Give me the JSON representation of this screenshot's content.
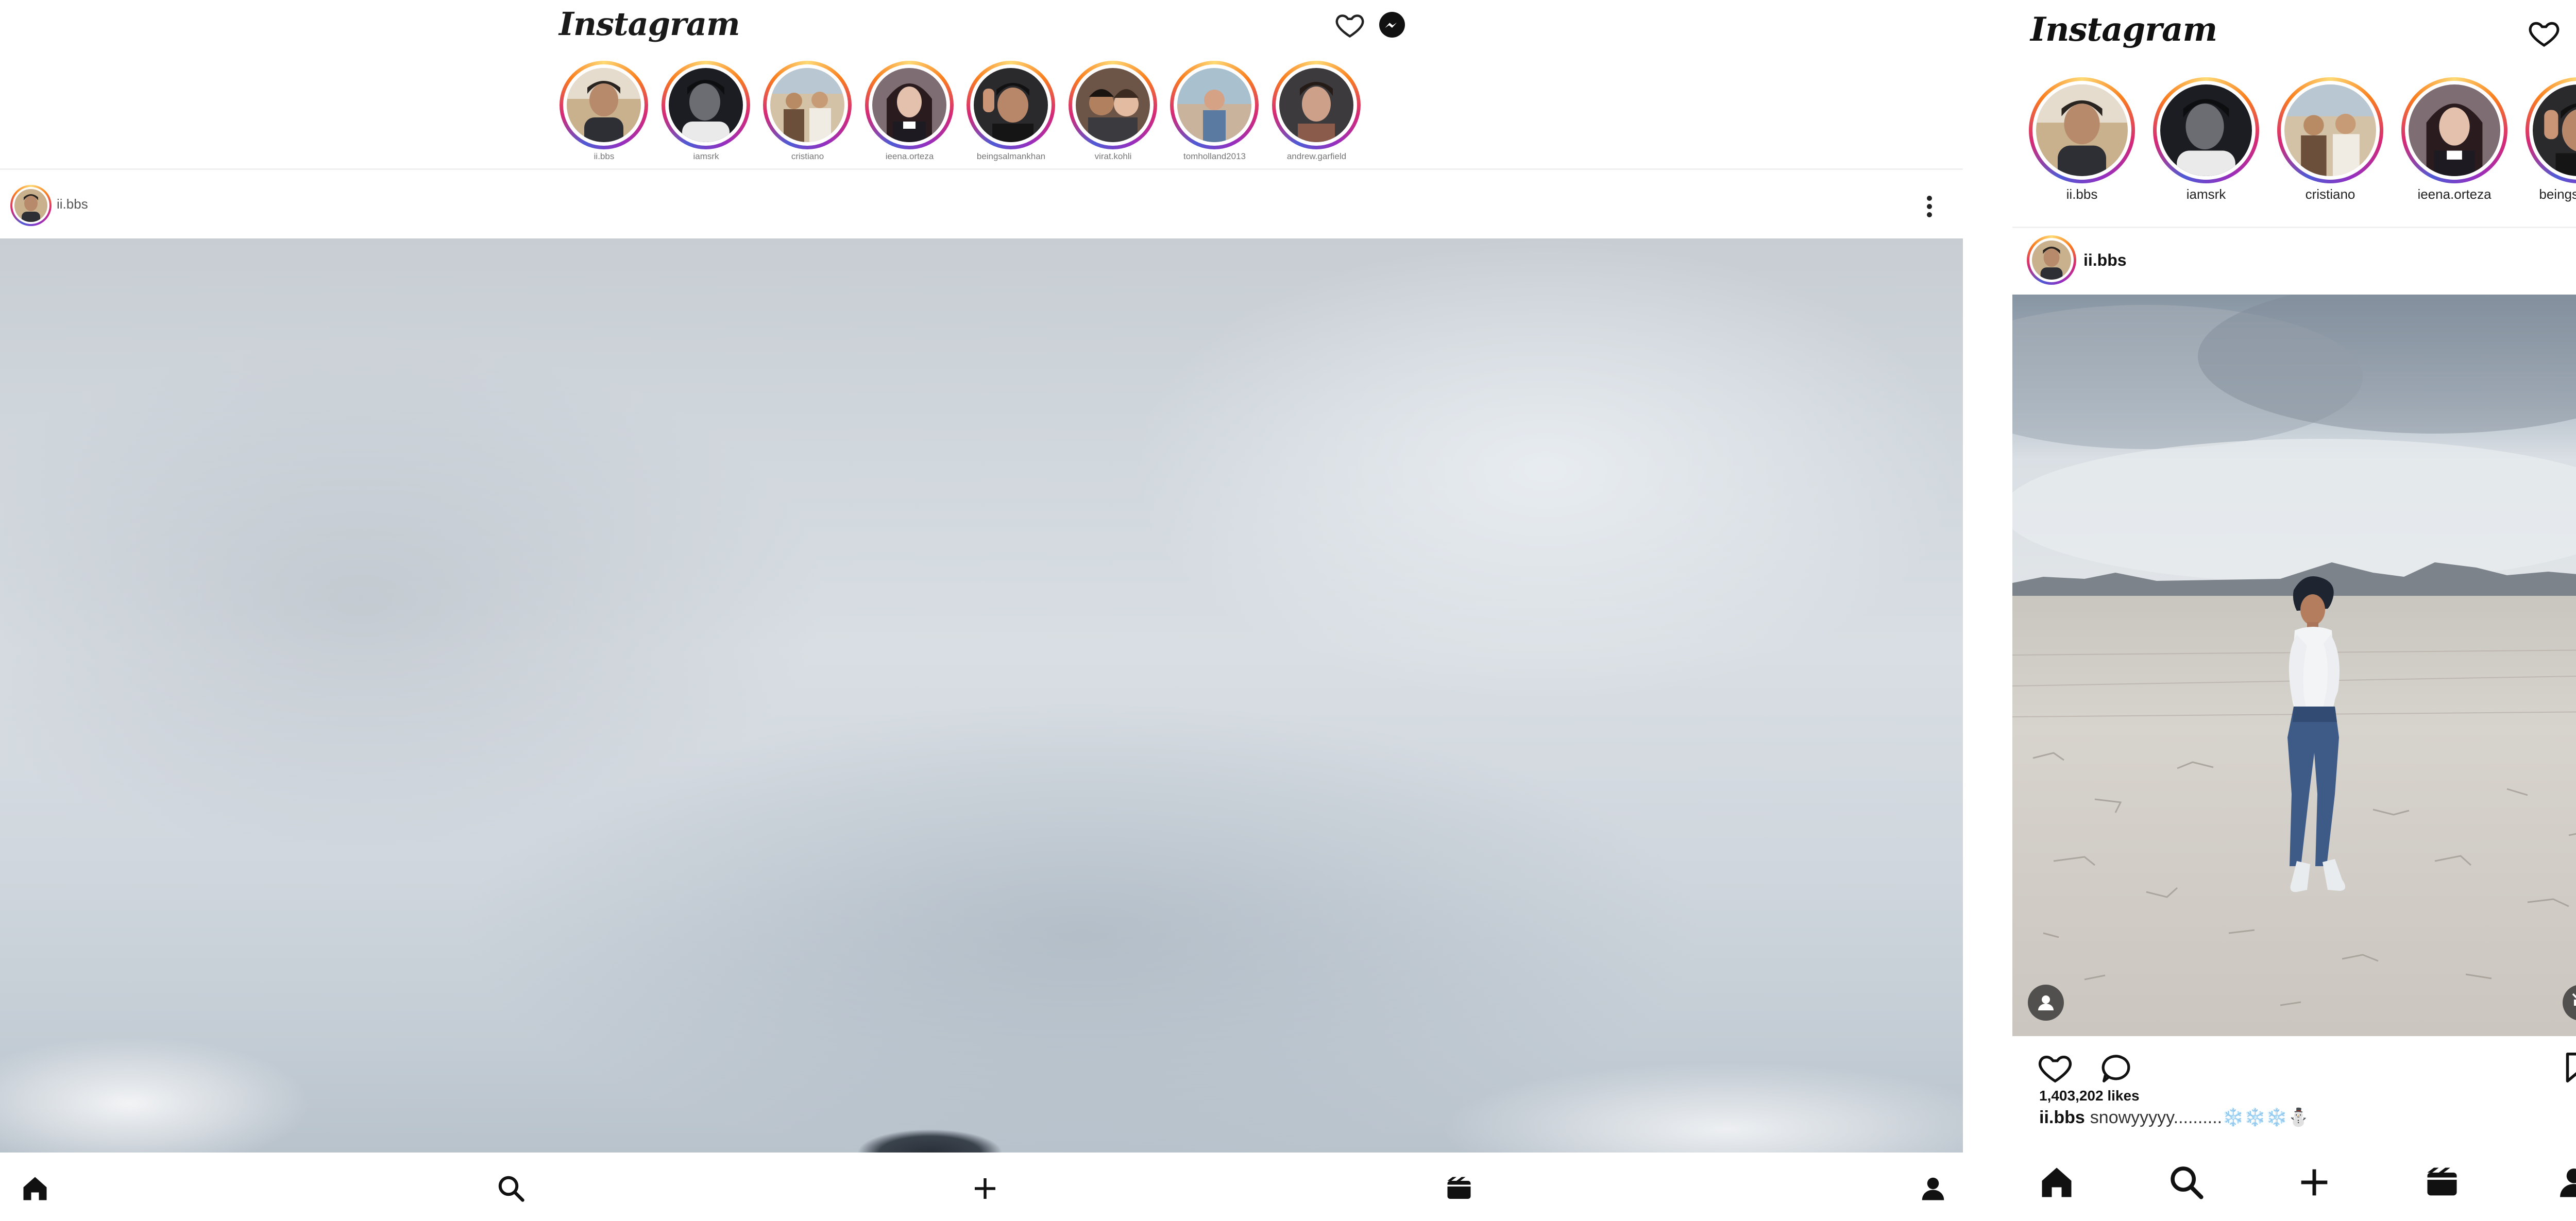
{
  "wide_view": {
    "logo": "Instagram",
    "stories": [
      {
        "username": "ii.bbs"
      },
      {
        "username": "iamsrk"
      },
      {
        "username": "cristiano"
      },
      {
        "username": "ieena.orteza"
      },
      {
        "username": "beingsalmankhan"
      },
      {
        "username": "virat.kohli"
      },
      {
        "username": "tomholland2013"
      },
      {
        "username": "andrew.garfield"
      }
    ],
    "post": {
      "username": "ii.bbs"
    }
  },
  "phone_view": {
    "logo": "Instagram",
    "stories": [
      {
        "username": "ii.bbs"
      },
      {
        "username": "iamsrk"
      },
      {
        "username": "cristiano"
      },
      {
        "username": "ieena.orteza"
      },
      {
        "username": "beingsalmanl"
      }
    ],
    "post": {
      "username": "ii.bbs",
      "likes": "1,403,202 likes",
      "caption_user": "ii.bbs",
      "caption_text": "snowyyyyy..........",
      "caption_emoji": "❄️❄️❄️⛄"
    }
  },
  "icons": {
    "header": [
      "heart-icon",
      "messenger-icon"
    ],
    "post": [
      "more-options-icon",
      "like-icon",
      "comment-icon",
      "save-icon",
      "tag-user-icon",
      "muted-icon"
    ],
    "nav": [
      "home-icon",
      "search-icon",
      "create-icon",
      "reels-icon",
      "profile-icon"
    ]
  },
  "colors": {
    "story_ring_start": "#feda75",
    "story_ring_mid": "#d62976",
    "story_ring_end": "#4f5bd5",
    "text": "#111111",
    "muted_text": "#777777"
  }
}
